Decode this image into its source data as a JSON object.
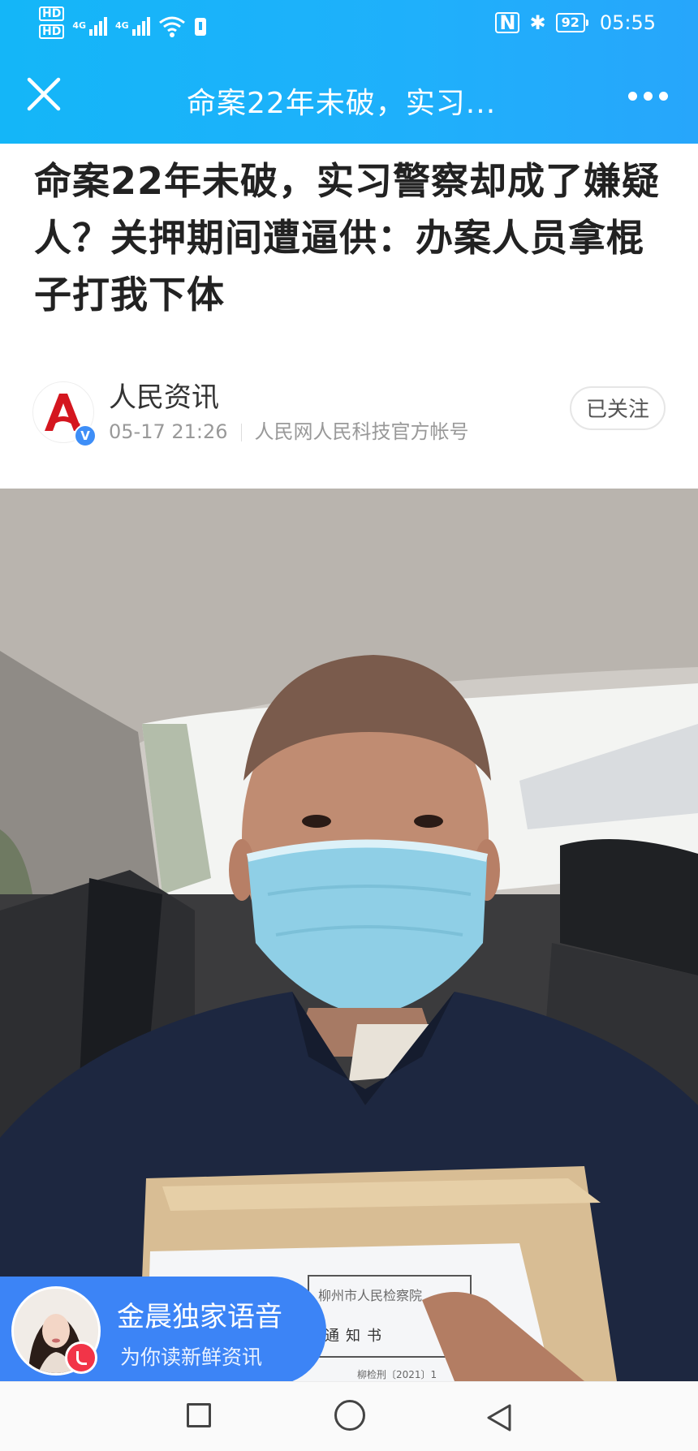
{
  "status_bar": {
    "hd_1": "HD",
    "hd_2": "HD",
    "network_1": "4G",
    "network_2": "4G",
    "battery": "92",
    "time": "05:55"
  },
  "nav": {
    "title": "命案22年未破，实习..."
  },
  "article": {
    "title": "命案22年未破，实习警察却成了嫌疑人？关押期间遭逼供：办案人员拿棍子打我下体"
  },
  "author": {
    "name": "人民资讯",
    "verified_badge": "V",
    "date": "05-17 21:26",
    "account_desc": "人民网人民科技官方帐号",
    "follow_label": "已关注"
  },
  "photo": {
    "document_text_1": "柳州市人民检察院",
    "document_text_2": "通知书",
    "document_text_3": "柳检刑〔2021〕1"
  },
  "audio_card": {
    "title": "金晨独家语音",
    "subtitle": "为你读新鲜资讯"
  },
  "colors": {
    "header": "#1fb0fb",
    "audio_card": "#3c84f6",
    "live_dot": "#f23448",
    "verified": "#3e8ef7"
  }
}
